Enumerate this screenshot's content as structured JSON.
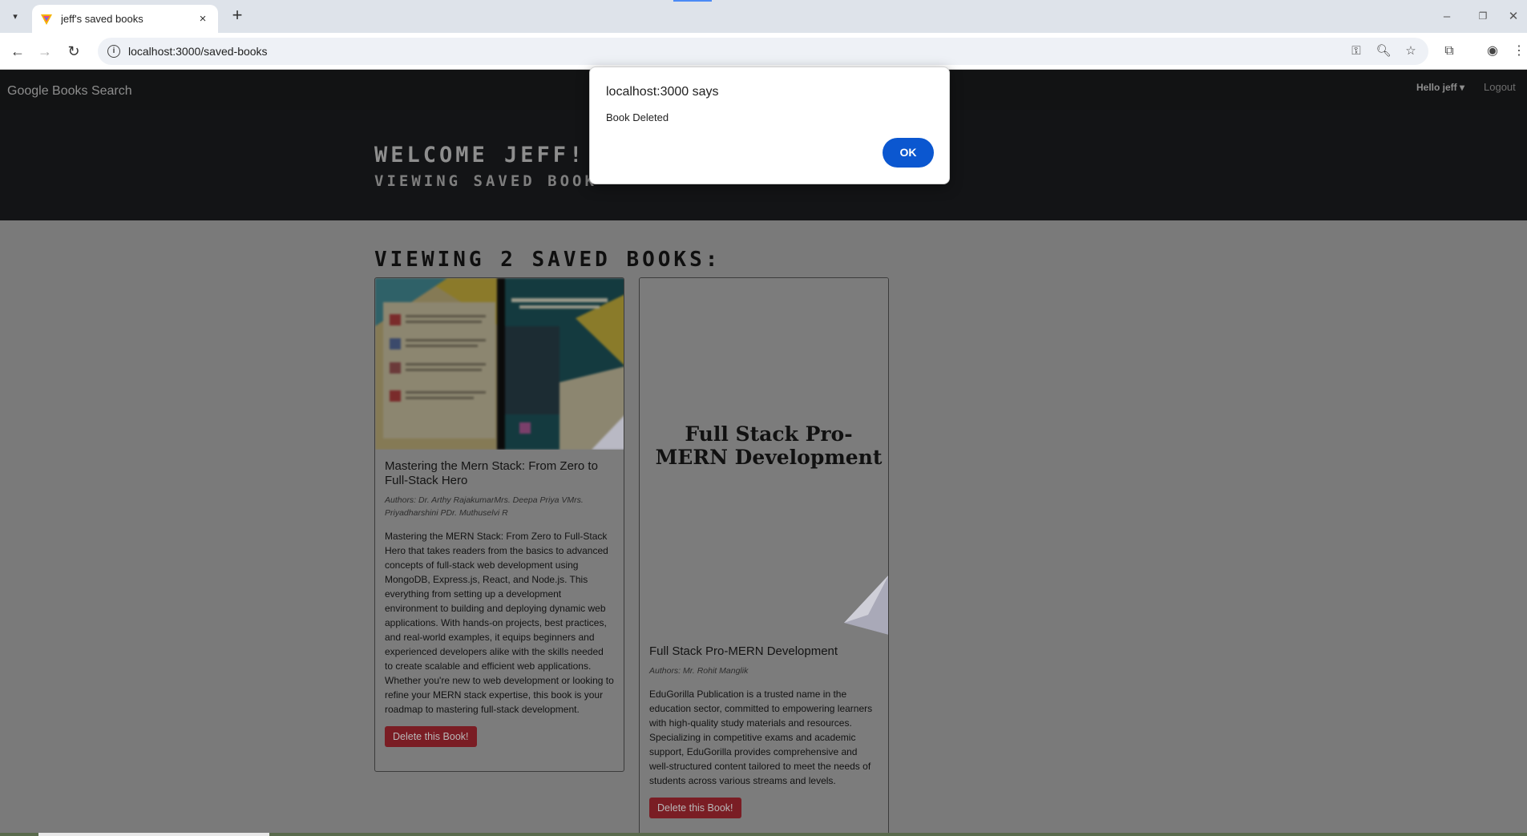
{
  "browser": {
    "tab_title": "jeff's saved books",
    "url": "localhost:3000/saved-books",
    "new_tab_symbol": "+",
    "tab_close_symbol": "×",
    "back_symbol": "←",
    "forward_symbol": "→",
    "reload_symbol": "↻",
    "minimize_symbol": "–",
    "restore_symbol": "❐",
    "close_symbol": "✕"
  },
  "navbar": {
    "brand": "Google Books Search",
    "user_menu": "Hello jeff ▾",
    "logout": "Logout"
  },
  "hero": {
    "title": "WELCOME JEFF!",
    "subtitle": "VIEWING SAVED BOOK"
  },
  "saved": {
    "heading": "VIEWING 2 SAVED BOOKS:",
    "books": [
      {
        "title": "Mastering the Mern Stack: From Zero to Full-Stack Hero",
        "authors": "Authors: Dr. Arthy RajakumarMrs. Deepa Priya VMrs. Priyadharshini PDr. Muthuselvi R",
        "description": "Mastering the MERN Stack: From Zero to Full-Stack Hero that takes readers from the basics to advanced concepts of full-stack web development using MongoDB, Express.js, React, and Node.js. This everything from setting up a development environment to building and deploying dynamic web applications. With hands-on projects, best practices, and real-world examples, it equips beginners and experienced developers alike with the skills needed to create scalable and efficient web applications. Whether you're new to web development or looking to refine your MERN stack expertise, this book is your roadmap to mastering full-stack development.",
        "delete_label": "Delete this Book!"
      },
      {
        "title": "Full Stack Pro-MERN Development",
        "cover_text": "Full Stack Pro-MERN Development",
        "authors": "Authors: Mr. Rohit Manglik",
        "description": "EduGorilla Publication is a trusted name in the education sector, committed to empowering learners with high-quality study materials and resources. Specializing in competitive exams and academic support, EduGorilla provides comprehensive and well-structured content tailored to meet the needs of students across various streams and levels.",
        "delete_label": "Delete this Book!"
      }
    ]
  },
  "dialog": {
    "title": "localhost:3000 says",
    "message": "Book Deleted",
    "ok_label": "OK"
  },
  "colors": {
    "dialog_button": "#0b57d0",
    "delete_button": "#7a1d24",
    "hero_bg": "#131416"
  }
}
